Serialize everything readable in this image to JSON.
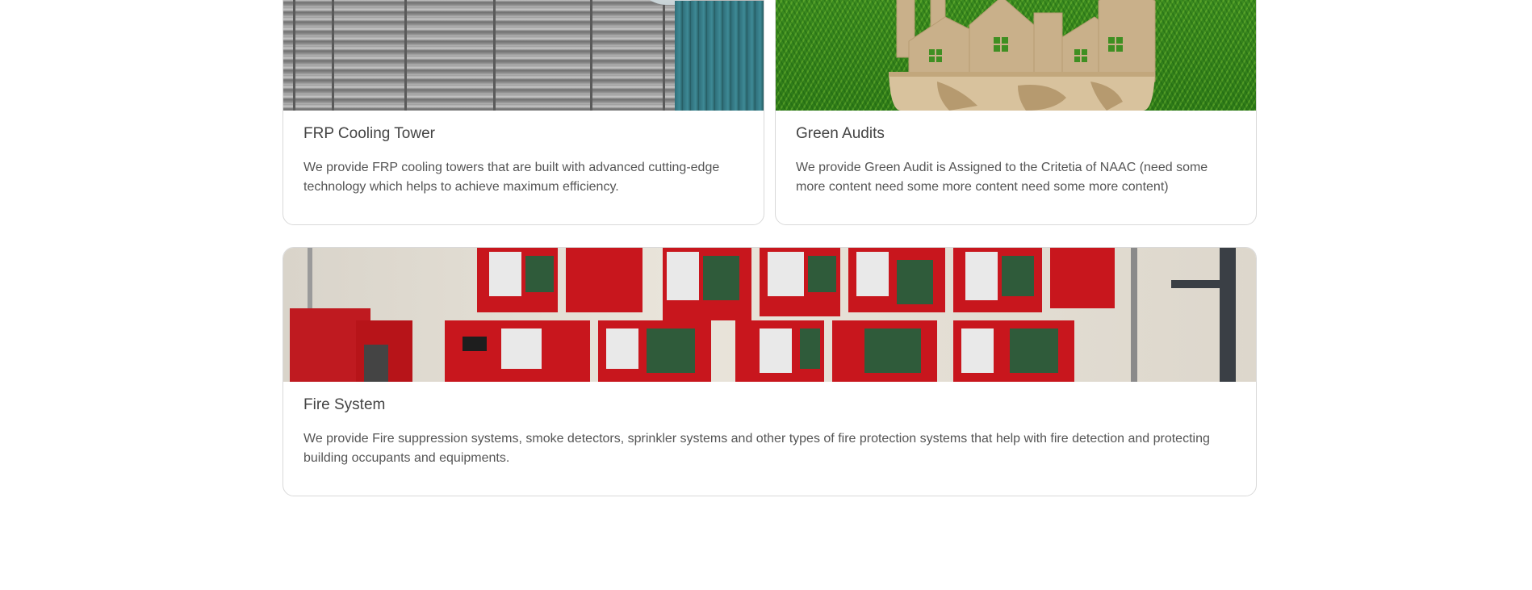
{
  "cards": [
    {
      "title": "FRP Cooling Tower",
      "description": "We provide FRP cooling towers that are built with advanced cutting-edge technology which helps to achieve maximum efficiency.",
      "image": "cooling-tower-photo"
    },
    {
      "title": "Green Audits",
      "description": "We provide Green Audit is Assigned to the Critetia of NAAC (need some more content need some more content need some more content)",
      "image": "green-earth-city-photo"
    },
    {
      "title": "Fire System",
      "description": "We provide Fire suppression systems, smoke detectors, sprinkler systems and other types of fire protection systems that help with fire detection and protecting building occupants and equipments.",
      "image": "fire-alarm-panels-photo"
    }
  ],
  "colors": {
    "card_border": "#d9d9d9",
    "title": "#444444",
    "text": "#555555",
    "panel_red": "#c8161d",
    "grass_green": "#3f8f22",
    "earth_tan": "#c9b08a"
  }
}
